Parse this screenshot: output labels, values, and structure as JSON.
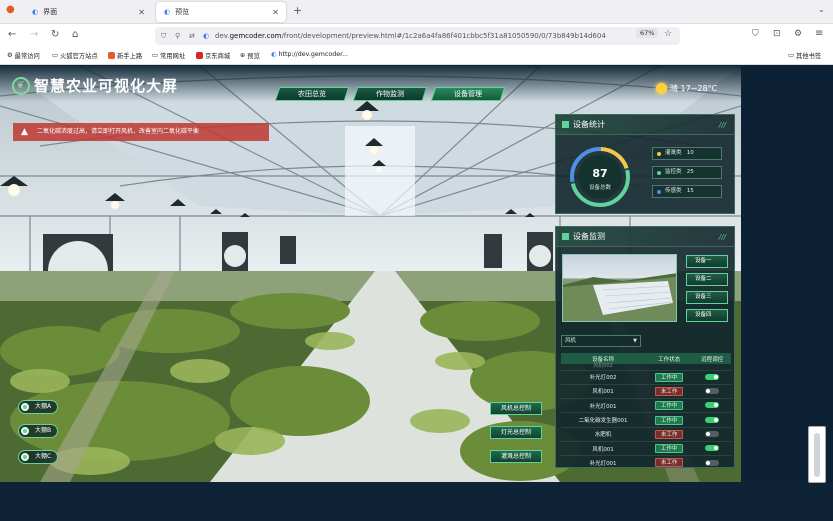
{
  "browser": {
    "tabs": [
      {
        "label": "界面"
      },
      {
        "label": "预览"
      }
    ],
    "url_prefix": "dev.",
    "url_domain": "gemcoder.com",
    "url_rest": "/front/development/preview.html#/1c2a6a4fa86f401cbbc5f31a81050590/0/73b849b14d604",
    "zoom": "67%",
    "bookmarks": [
      "最常访问",
      "火狐官方站点",
      "新手上路",
      "常用网址",
      "京东商城",
      "预览",
      "http://dev.gemcoder...",
      "其他书签"
    ]
  },
  "app": {
    "title": "智慧农业可视化大屏",
    "nav": [
      "农田总览",
      "作物监测",
      "设备管理"
    ],
    "weather": "晴 17~28°C",
    "alert": "二氧化碳浓度过高，请立即打开风机，改善室内二氧化碳平衡",
    "stats": {
      "title": "设备统计",
      "total": "87",
      "total_label": "设备总数",
      "rows": [
        {
          "label": "灌溉类",
          "value": "10",
          "color": "#f2c94c"
        },
        {
          "label": "监控类",
          "value": "25",
          "color": "#5fd39a"
        },
        {
          "label": "传感类",
          "value": "15",
          "color": "#4f8fe6"
        }
      ]
    },
    "monitor": {
      "title": "设备监测",
      "devices": [
        "设备一",
        "设备二",
        "设备三",
        "设备四"
      ],
      "filter": "风机",
      "headers": [
        "设备名称",
        "工作状态",
        "远程调控"
      ],
      "partial_row": "风机002",
      "rows": [
        {
          "name": "补光灯002",
          "status": "工作中",
          "state": "on"
        },
        {
          "name": "风机001",
          "status": "未工作",
          "state": "off"
        },
        {
          "name": "补光灯001",
          "status": "工作中",
          "state": "on"
        },
        {
          "name": "二氧化碳发生器001",
          "status": "工作中",
          "state": "on"
        },
        {
          "name": "水肥机",
          "status": "未工作",
          "state": "off"
        },
        {
          "name": "风机001",
          "status": "工作中",
          "state": "on"
        },
        {
          "name": "补光灯001",
          "status": "未工作",
          "state": "off"
        }
      ]
    },
    "sheds": [
      "大棚A",
      "大棚B",
      "大棚C"
    ],
    "controls": [
      "风机总控制",
      "灯光总控制",
      "灌溉总控制"
    ]
  }
}
